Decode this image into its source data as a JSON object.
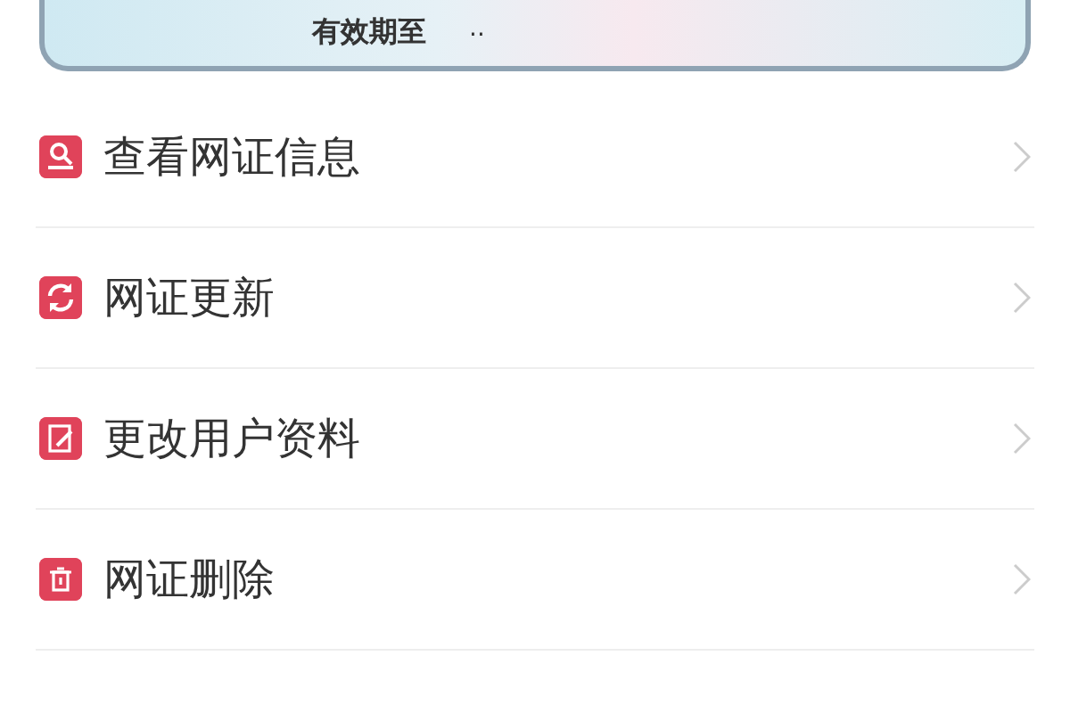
{
  "card": {
    "expiry_label": "有效期至",
    "expiry_value": ".."
  },
  "menu": [
    {
      "kind": "view",
      "label": "查看网证信息"
    },
    {
      "kind": "renew",
      "label": "网证更新"
    },
    {
      "kind": "edit",
      "label": "更改用户资料"
    },
    {
      "kind": "delete",
      "label": "网证删除"
    }
  ]
}
